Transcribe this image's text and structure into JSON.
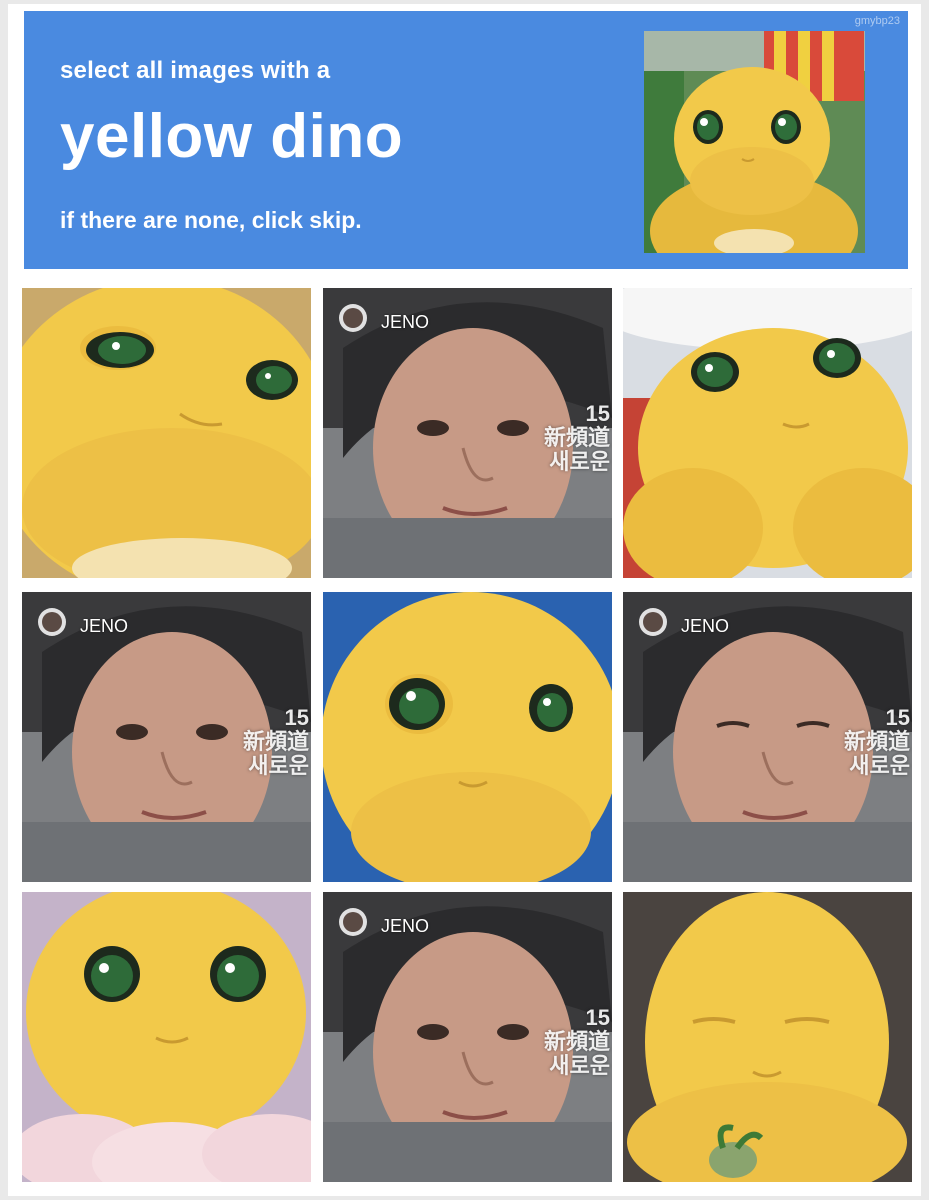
{
  "watermark": "gmybp23",
  "header": {
    "line1": "select all images with a",
    "line2": "yellow dino",
    "line3": "if there are none, click skip."
  },
  "jeno": {
    "label": "JENO",
    "side_number": "15",
    "side_text_1": "新頻道",
    "side_text_2": "새로운"
  },
  "tiles": [
    {
      "content": "yellow-dino"
    },
    {
      "content": "jeno"
    },
    {
      "content": "yellow-dino"
    },
    {
      "content": "jeno"
    },
    {
      "content": "yellow-dino"
    },
    {
      "content": "jeno"
    },
    {
      "content": "yellow-dino"
    },
    {
      "content": "jeno"
    },
    {
      "content": "yellow-dino"
    }
  ],
  "colors": {
    "header_bg": "#4a8ae0",
    "dino_yellow": "#f2c94a",
    "dino_shade": "#d9a82e"
  }
}
